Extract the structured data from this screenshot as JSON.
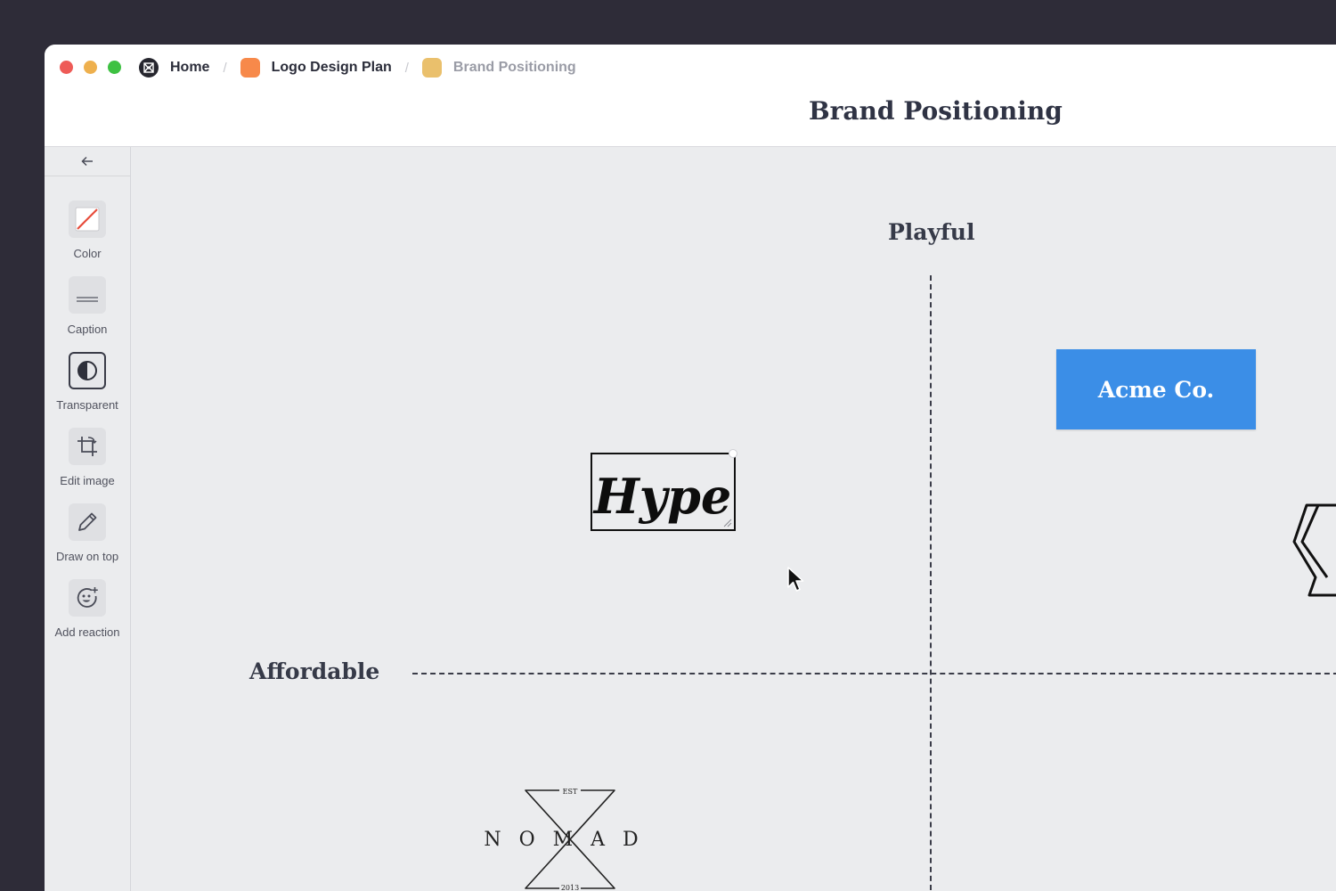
{
  "breadcrumbs": {
    "home": "Home",
    "separator": "/",
    "plan": "Logo Design Plan",
    "current": "Brand Positioning",
    "plan_color": "#f7894a",
    "current_color": "#eac06c"
  },
  "page_title": "Brand Positioning",
  "sidebar": {
    "collapse_icon": "arrow-left-icon",
    "tools": [
      {
        "label": "Color",
        "icon": "color-swatch-icon"
      },
      {
        "label": "Caption",
        "icon": "caption-icon"
      },
      {
        "label": "Transparent",
        "icon": "contrast-icon"
      },
      {
        "label": "Edit image",
        "icon": "crop-icon"
      },
      {
        "label": "Draw on top",
        "icon": "pencil-icon"
      },
      {
        "label": "Add reaction",
        "icon": "emoji-add-icon"
      }
    ]
  },
  "canvas": {
    "axis_top": "Playful",
    "axis_left": "Affordable",
    "cards": {
      "acme": "Acme Co.",
      "hype": "Hype",
      "nomad": {
        "word": "NOMAD",
        "est": "EST",
        "year": "2013"
      }
    },
    "accent": "#3b8ee7"
  }
}
